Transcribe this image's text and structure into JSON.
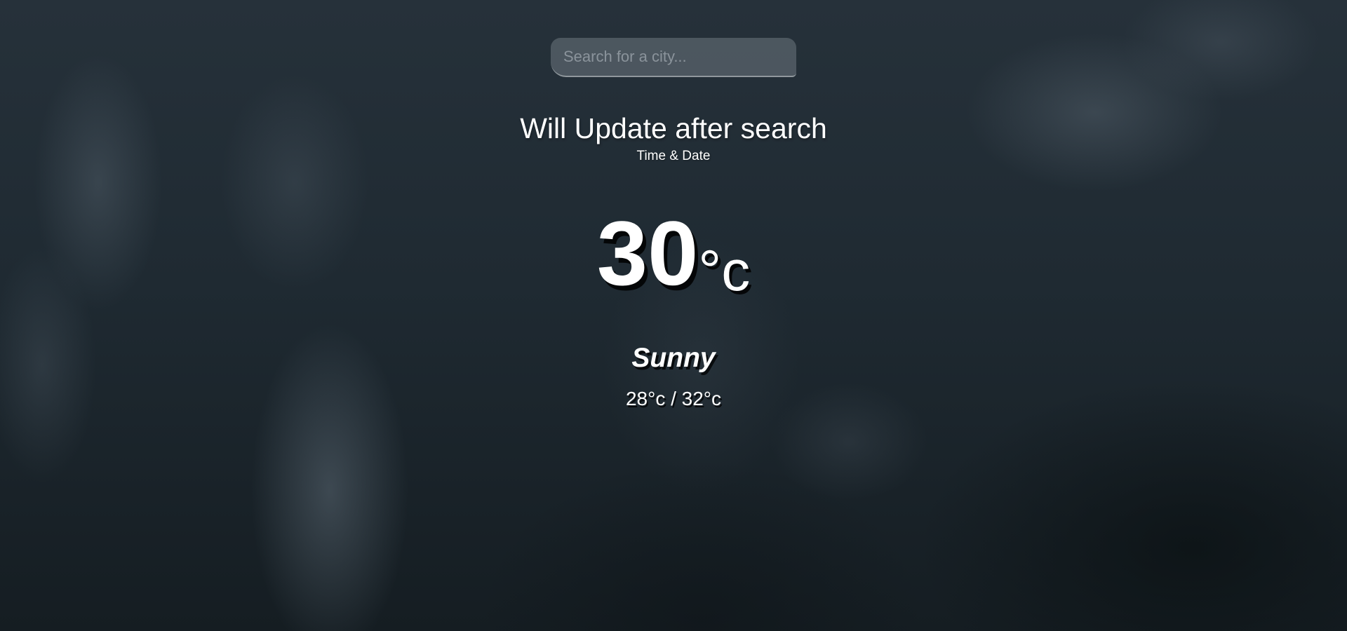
{
  "search": {
    "placeholder": "Search for a city...",
    "value": ""
  },
  "location": {
    "city": "Will Update after search",
    "date": "Time & Date"
  },
  "current": {
    "temperature": "30",
    "unit": "°c",
    "condition": "Sunny",
    "hi_low": "28°c / 32°c"
  }
}
